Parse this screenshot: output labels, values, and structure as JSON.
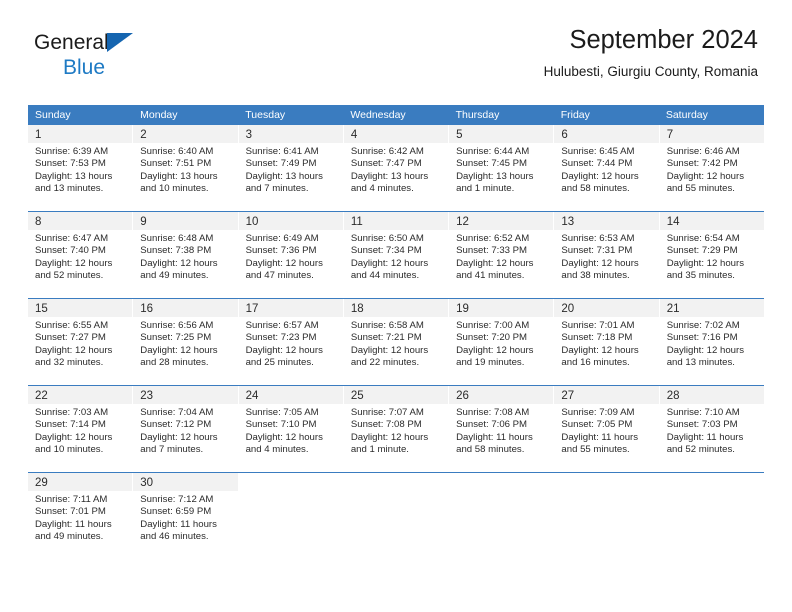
{
  "brand": {
    "line1": "General",
    "line2": "Blue",
    "triangle_color": "#1565b0",
    "text_color": "#1b1b1b",
    "blue_color": "#1e7ac4"
  },
  "header": {
    "title": "September 2024",
    "subtitle": "Hulubesti, Giurgiu County, Romania"
  },
  "calendar": {
    "header_bg": "#3a7cc0",
    "daynum_bg": "#f2f2f2",
    "weekdays": [
      "Sunday",
      "Monday",
      "Tuesday",
      "Wednesday",
      "Thursday",
      "Friday",
      "Saturday"
    ],
    "weeks": [
      [
        {
          "day": "1",
          "sunrise": "Sunrise: 6:39 AM",
          "sunset": "Sunset: 7:53 PM",
          "daylight1": "Daylight: 13 hours",
          "daylight2": "and 13 minutes."
        },
        {
          "day": "2",
          "sunrise": "Sunrise: 6:40 AM",
          "sunset": "Sunset: 7:51 PM",
          "daylight1": "Daylight: 13 hours",
          "daylight2": "and 10 minutes."
        },
        {
          "day": "3",
          "sunrise": "Sunrise: 6:41 AM",
          "sunset": "Sunset: 7:49 PM",
          "daylight1": "Daylight: 13 hours",
          "daylight2": "and 7 minutes."
        },
        {
          "day": "4",
          "sunrise": "Sunrise: 6:42 AM",
          "sunset": "Sunset: 7:47 PM",
          "daylight1": "Daylight: 13 hours",
          "daylight2": "and 4 minutes."
        },
        {
          "day": "5",
          "sunrise": "Sunrise: 6:44 AM",
          "sunset": "Sunset: 7:45 PM",
          "daylight1": "Daylight: 13 hours",
          "daylight2": "and 1 minute."
        },
        {
          "day": "6",
          "sunrise": "Sunrise: 6:45 AM",
          "sunset": "Sunset: 7:44 PM",
          "daylight1": "Daylight: 12 hours",
          "daylight2": "and 58 minutes."
        },
        {
          "day": "7",
          "sunrise": "Sunrise: 6:46 AM",
          "sunset": "Sunset: 7:42 PM",
          "daylight1": "Daylight: 12 hours",
          "daylight2": "and 55 minutes."
        }
      ],
      [
        {
          "day": "8",
          "sunrise": "Sunrise: 6:47 AM",
          "sunset": "Sunset: 7:40 PM",
          "daylight1": "Daylight: 12 hours",
          "daylight2": "and 52 minutes."
        },
        {
          "day": "9",
          "sunrise": "Sunrise: 6:48 AM",
          "sunset": "Sunset: 7:38 PM",
          "daylight1": "Daylight: 12 hours",
          "daylight2": "and 49 minutes."
        },
        {
          "day": "10",
          "sunrise": "Sunrise: 6:49 AM",
          "sunset": "Sunset: 7:36 PM",
          "daylight1": "Daylight: 12 hours",
          "daylight2": "and 47 minutes."
        },
        {
          "day": "11",
          "sunrise": "Sunrise: 6:50 AM",
          "sunset": "Sunset: 7:34 PM",
          "daylight1": "Daylight: 12 hours",
          "daylight2": "and 44 minutes."
        },
        {
          "day": "12",
          "sunrise": "Sunrise: 6:52 AM",
          "sunset": "Sunset: 7:33 PM",
          "daylight1": "Daylight: 12 hours",
          "daylight2": "and 41 minutes."
        },
        {
          "day": "13",
          "sunrise": "Sunrise: 6:53 AM",
          "sunset": "Sunset: 7:31 PM",
          "daylight1": "Daylight: 12 hours",
          "daylight2": "and 38 minutes."
        },
        {
          "day": "14",
          "sunrise": "Sunrise: 6:54 AM",
          "sunset": "Sunset: 7:29 PM",
          "daylight1": "Daylight: 12 hours",
          "daylight2": "and 35 minutes."
        }
      ],
      [
        {
          "day": "15",
          "sunrise": "Sunrise: 6:55 AM",
          "sunset": "Sunset: 7:27 PM",
          "daylight1": "Daylight: 12 hours",
          "daylight2": "and 32 minutes."
        },
        {
          "day": "16",
          "sunrise": "Sunrise: 6:56 AM",
          "sunset": "Sunset: 7:25 PM",
          "daylight1": "Daylight: 12 hours",
          "daylight2": "and 28 minutes."
        },
        {
          "day": "17",
          "sunrise": "Sunrise: 6:57 AM",
          "sunset": "Sunset: 7:23 PM",
          "daylight1": "Daylight: 12 hours",
          "daylight2": "and 25 minutes."
        },
        {
          "day": "18",
          "sunrise": "Sunrise: 6:58 AM",
          "sunset": "Sunset: 7:21 PM",
          "daylight1": "Daylight: 12 hours",
          "daylight2": "and 22 minutes."
        },
        {
          "day": "19",
          "sunrise": "Sunrise: 7:00 AM",
          "sunset": "Sunset: 7:20 PM",
          "daylight1": "Daylight: 12 hours",
          "daylight2": "and 19 minutes."
        },
        {
          "day": "20",
          "sunrise": "Sunrise: 7:01 AM",
          "sunset": "Sunset: 7:18 PM",
          "daylight1": "Daylight: 12 hours",
          "daylight2": "and 16 minutes."
        },
        {
          "day": "21",
          "sunrise": "Sunrise: 7:02 AM",
          "sunset": "Sunset: 7:16 PM",
          "daylight1": "Daylight: 12 hours",
          "daylight2": "and 13 minutes."
        }
      ],
      [
        {
          "day": "22",
          "sunrise": "Sunrise: 7:03 AM",
          "sunset": "Sunset: 7:14 PM",
          "daylight1": "Daylight: 12 hours",
          "daylight2": "and 10 minutes."
        },
        {
          "day": "23",
          "sunrise": "Sunrise: 7:04 AM",
          "sunset": "Sunset: 7:12 PM",
          "daylight1": "Daylight: 12 hours",
          "daylight2": "and 7 minutes."
        },
        {
          "day": "24",
          "sunrise": "Sunrise: 7:05 AM",
          "sunset": "Sunset: 7:10 PM",
          "daylight1": "Daylight: 12 hours",
          "daylight2": "and 4 minutes."
        },
        {
          "day": "25",
          "sunrise": "Sunrise: 7:07 AM",
          "sunset": "Sunset: 7:08 PM",
          "daylight1": "Daylight: 12 hours",
          "daylight2": "and 1 minute."
        },
        {
          "day": "26",
          "sunrise": "Sunrise: 7:08 AM",
          "sunset": "Sunset: 7:06 PM",
          "daylight1": "Daylight: 11 hours",
          "daylight2": "and 58 minutes."
        },
        {
          "day": "27",
          "sunrise": "Sunrise: 7:09 AM",
          "sunset": "Sunset: 7:05 PM",
          "daylight1": "Daylight: 11 hours",
          "daylight2": "and 55 minutes."
        },
        {
          "day": "28",
          "sunrise": "Sunrise: 7:10 AM",
          "sunset": "Sunset: 7:03 PM",
          "daylight1": "Daylight: 11 hours",
          "daylight2": "and 52 minutes."
        }
      ],
      [
        {
          "day": "29",
          "sunrise": "Sunrise: 7:11 AM",
          "sunset": "Sunset: 7:01 PM",
          "daylight1": "Daylight: 11 hours",
          "daylight2": "and 49 minutes."
        },
        {
          "day": "30",
          "sunrise": "Sunrise: 7:12 AM",
          "sunset": "Sunset: 6:59 PM",
          "daylight1": "Daylight: 11 hours",
          "daylight2": "and 46 minutes."
        },
        {
          "day": "",
          "sunrise": "",
          "sunset": "",
          "daylight1": "",
          "daylight2": ""
        },
        {
          "day": "",
          "sunrise": "",
          "sunset": "",
          "daylight1": "",
          "daylight2": ""
        },
        {
          "day": "",
          "sunrise": "",
          "sunset": "",
          "daylight1": "",
          "daylight2": ""
        },
        {
          "day": "",
          "sunrise": "",
          "sunset": "",
          "daylight1": "",
          "daylight2": ""
        },
        {
          "day": "",
          "sunrise": "",
          "sunset": "",
          "daylight1": "",
          "daylight2": ""
        }
      ]
    ]
  }
}
